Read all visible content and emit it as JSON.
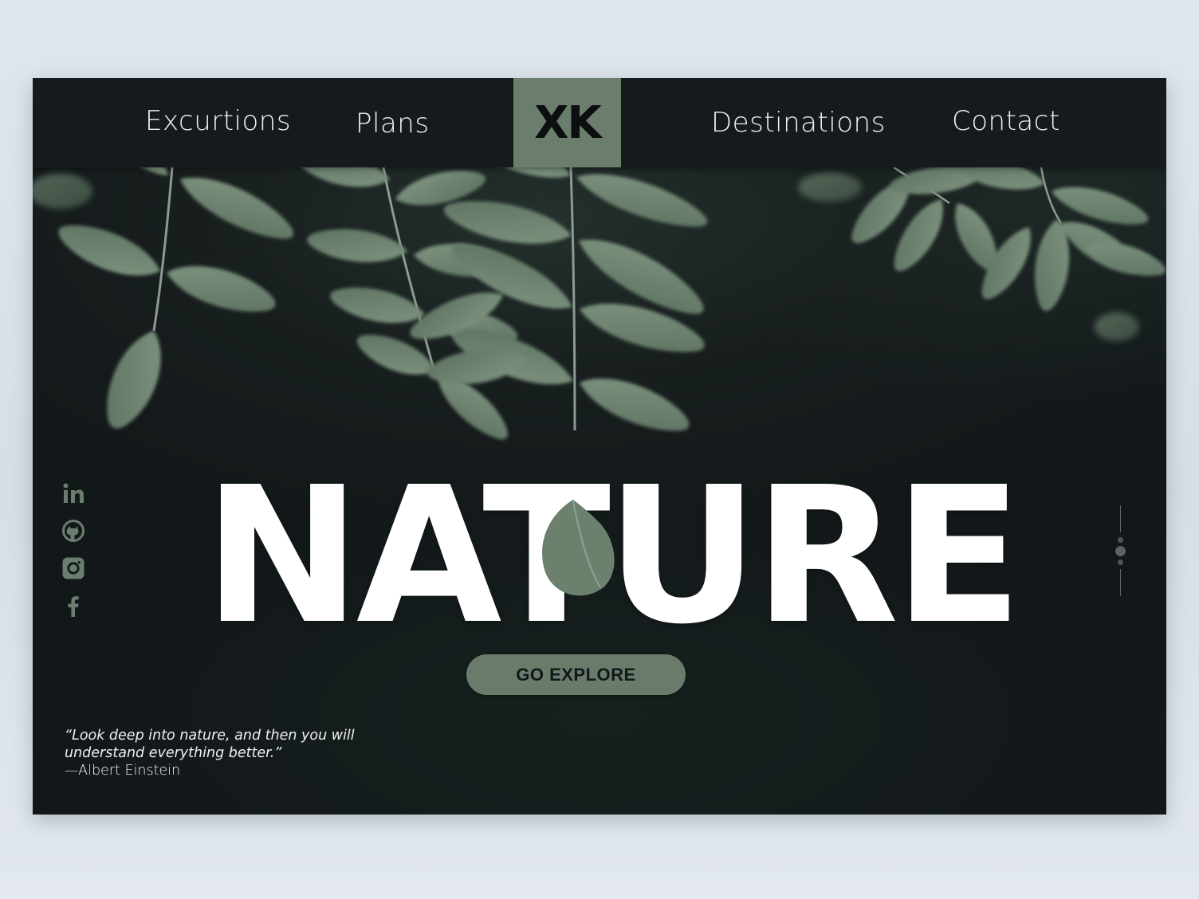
{
  "nav": {
    "links": [
      "Excurtions",
      "Plans",
      "Destinations",
      "Contact"
    ],
    "logo": "XK"
  },
  "hero": {
    "headline": "NATURE",
    "cta_label": "GO EXPLORE",
    "quote": {
      "text": "“Look deep into nature, and then you will\n understand everything better.”",
      "author": "—Albert Einstein"
    }
  },
  "social_icons": [
    "linkedin-icon",
    "github-icon",
    "instagram-icon",
    "facebook-icon"
  ],
  "slider": {
    "slides": 3,
    "active_index": 1
  },
  "colors": {
    "accent_sage": "#6b7d6d",
    "nav_background": "#151b1d",
    "hero_background": "#121719",
    "leaf": "#6f8672",
    "text_light": "#eef1ef"
  }
}
